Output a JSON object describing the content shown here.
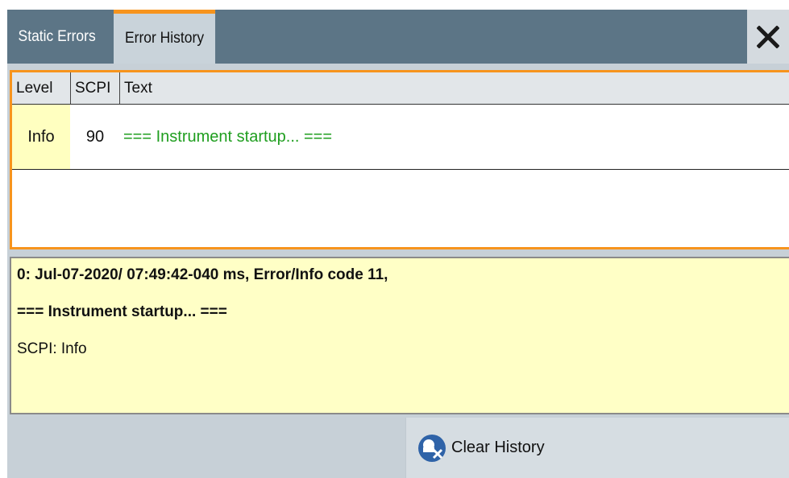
{
  "tabs": {
    "static_errors": "Static Errors",
    "error_history": "Error History"
  },
  "close_icon": "close-icon",
  "table": {
    "headers": [
      "Level",
      "SCPI",
      "Text"
    ],
    "rows": [
      {
        "level": "Info",
        "scpi": "90",
        "text": "=== Instrument startup... ==="
      }
    ]
  },
  "detail": {
    "line1": "0: Jul-07-2020/ 07:49:42-040 ms, Error/Info code 11,",
    "line2": "=== Instrument startup... ===",
    "line3": "SCPI: Info"
  },
  "clear_button": {
    "label": "Clear History",
    "icon": "clear-history-icon"
  },
  "colors": {
    "accent": "#f7941d",
    "tabbar": "#5c7586",
    "info_text": "#1f9e1f",
    "highlight": "#ffffc6"
  }
}
